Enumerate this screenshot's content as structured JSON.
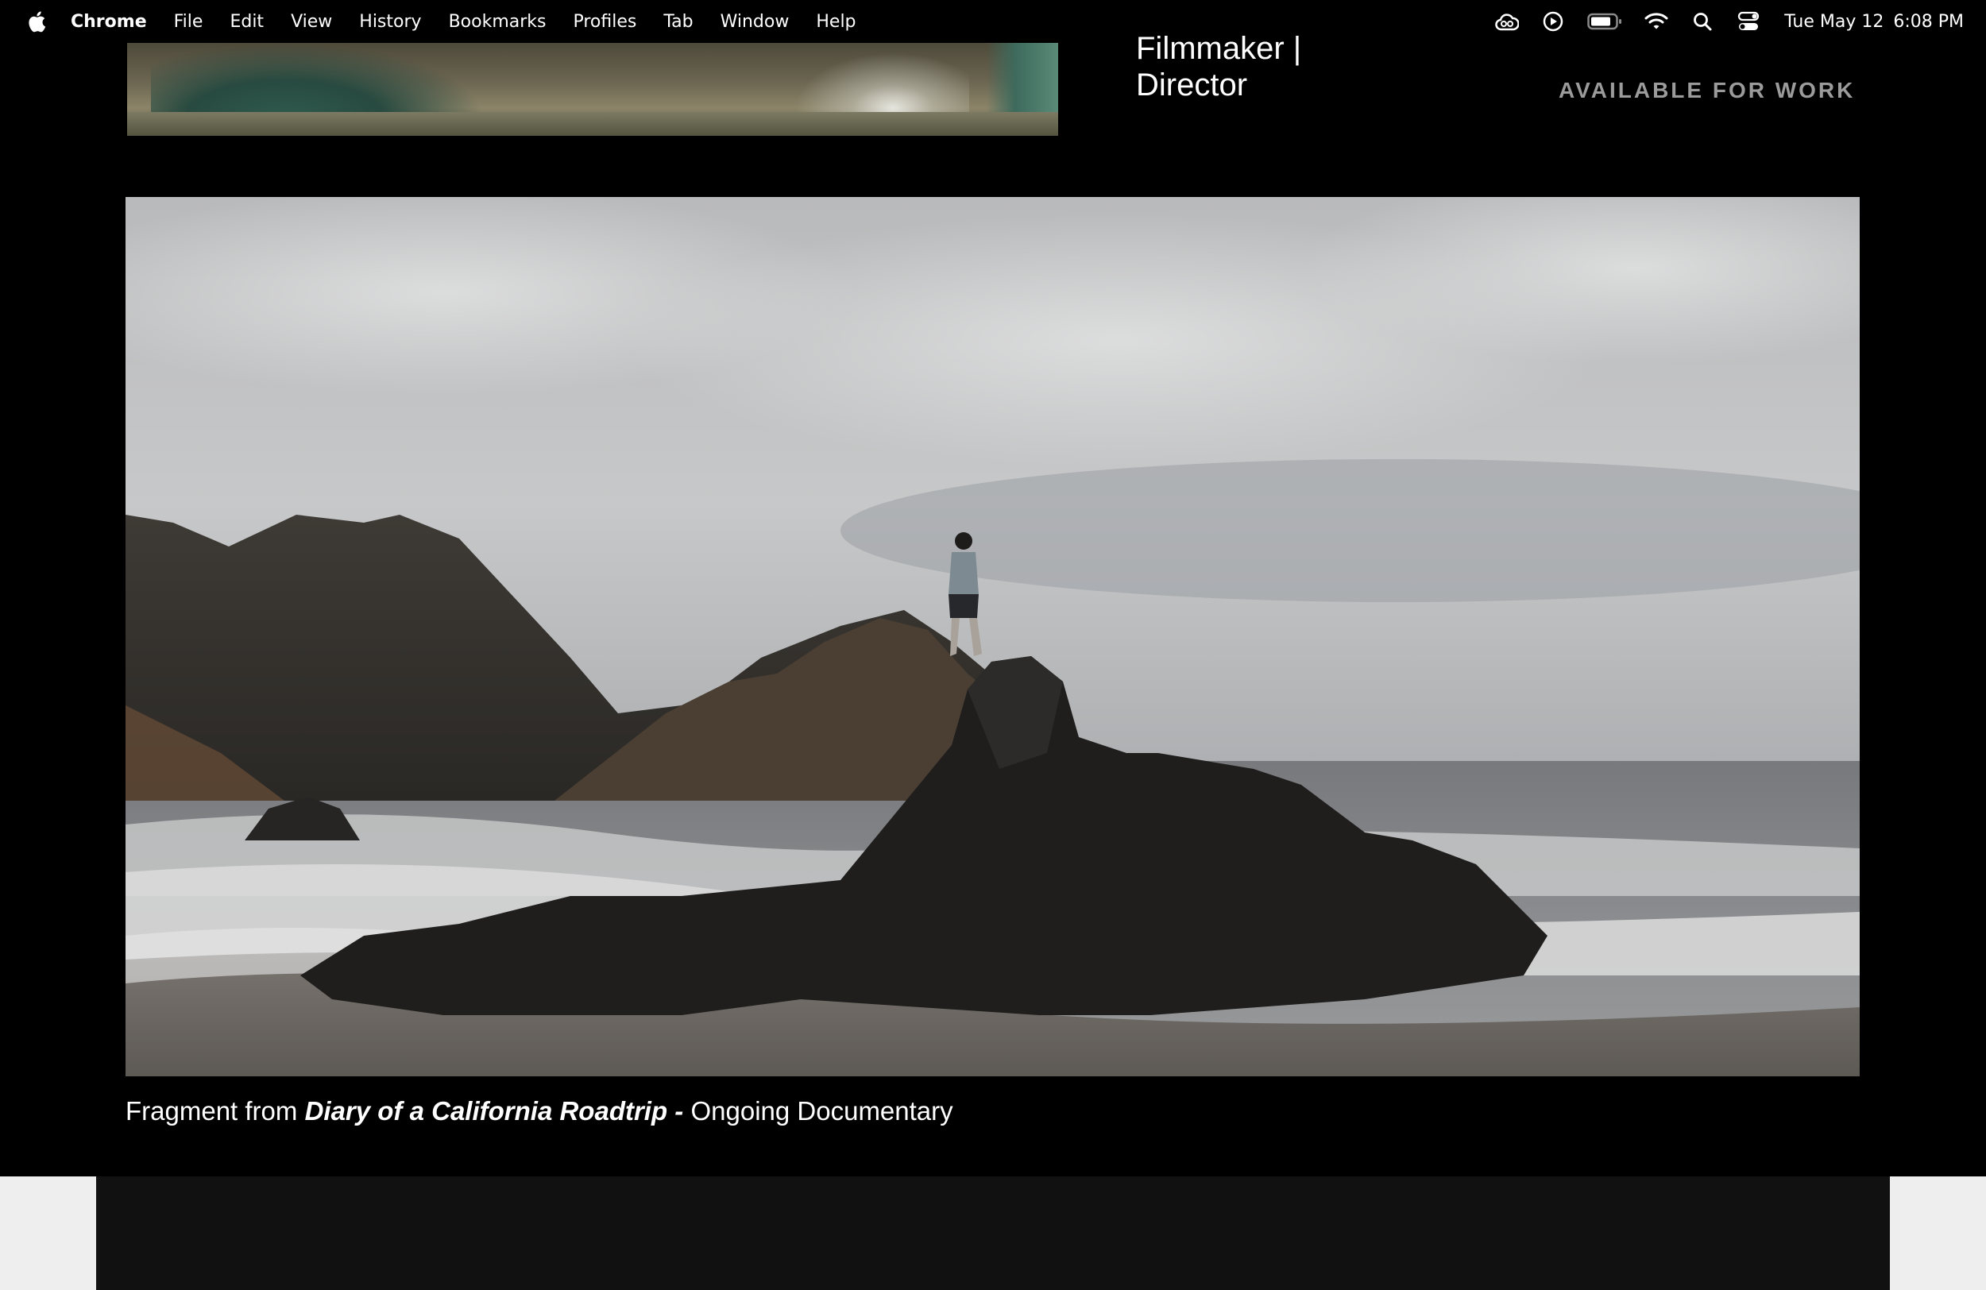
{
  "menubar": {
    "app_name": "Chrome",
    "items": [
      "File",
      "Edit",
      "View",
      "History",
      "Bookmarks",
      "Profiles",
      "Tab",
      "Window",
      "Help"
    ],
    "status_icons": [
      "adobe-cc-icon",
      "play-circle-icon",
      "battery-icon",
      "wifi-icon",
      "spotlight-search-icon",
      "control-center-icon"
    ],
    "date": "Tue May 12",
    "time": "6:08 PM"
  },
  "header": {
    "role_line1": "Filmmaker |",
    "role_line2": "Director",
    "availability": "AVAILABLE FOR WORK"
  },
  "feature": {
    "caption_prefix": "Fragment from",
    "caption_title": "Diary of a California Roadtrip -",
    "caption_suffix": "Ongoing Documentary"
  },
  "colors": {
    "background": "#000000",
    "availability_text": "#9b9b9b",
    "lower_panel": "#111111",
    "page_margin": "#eeeeee"
  }
}
